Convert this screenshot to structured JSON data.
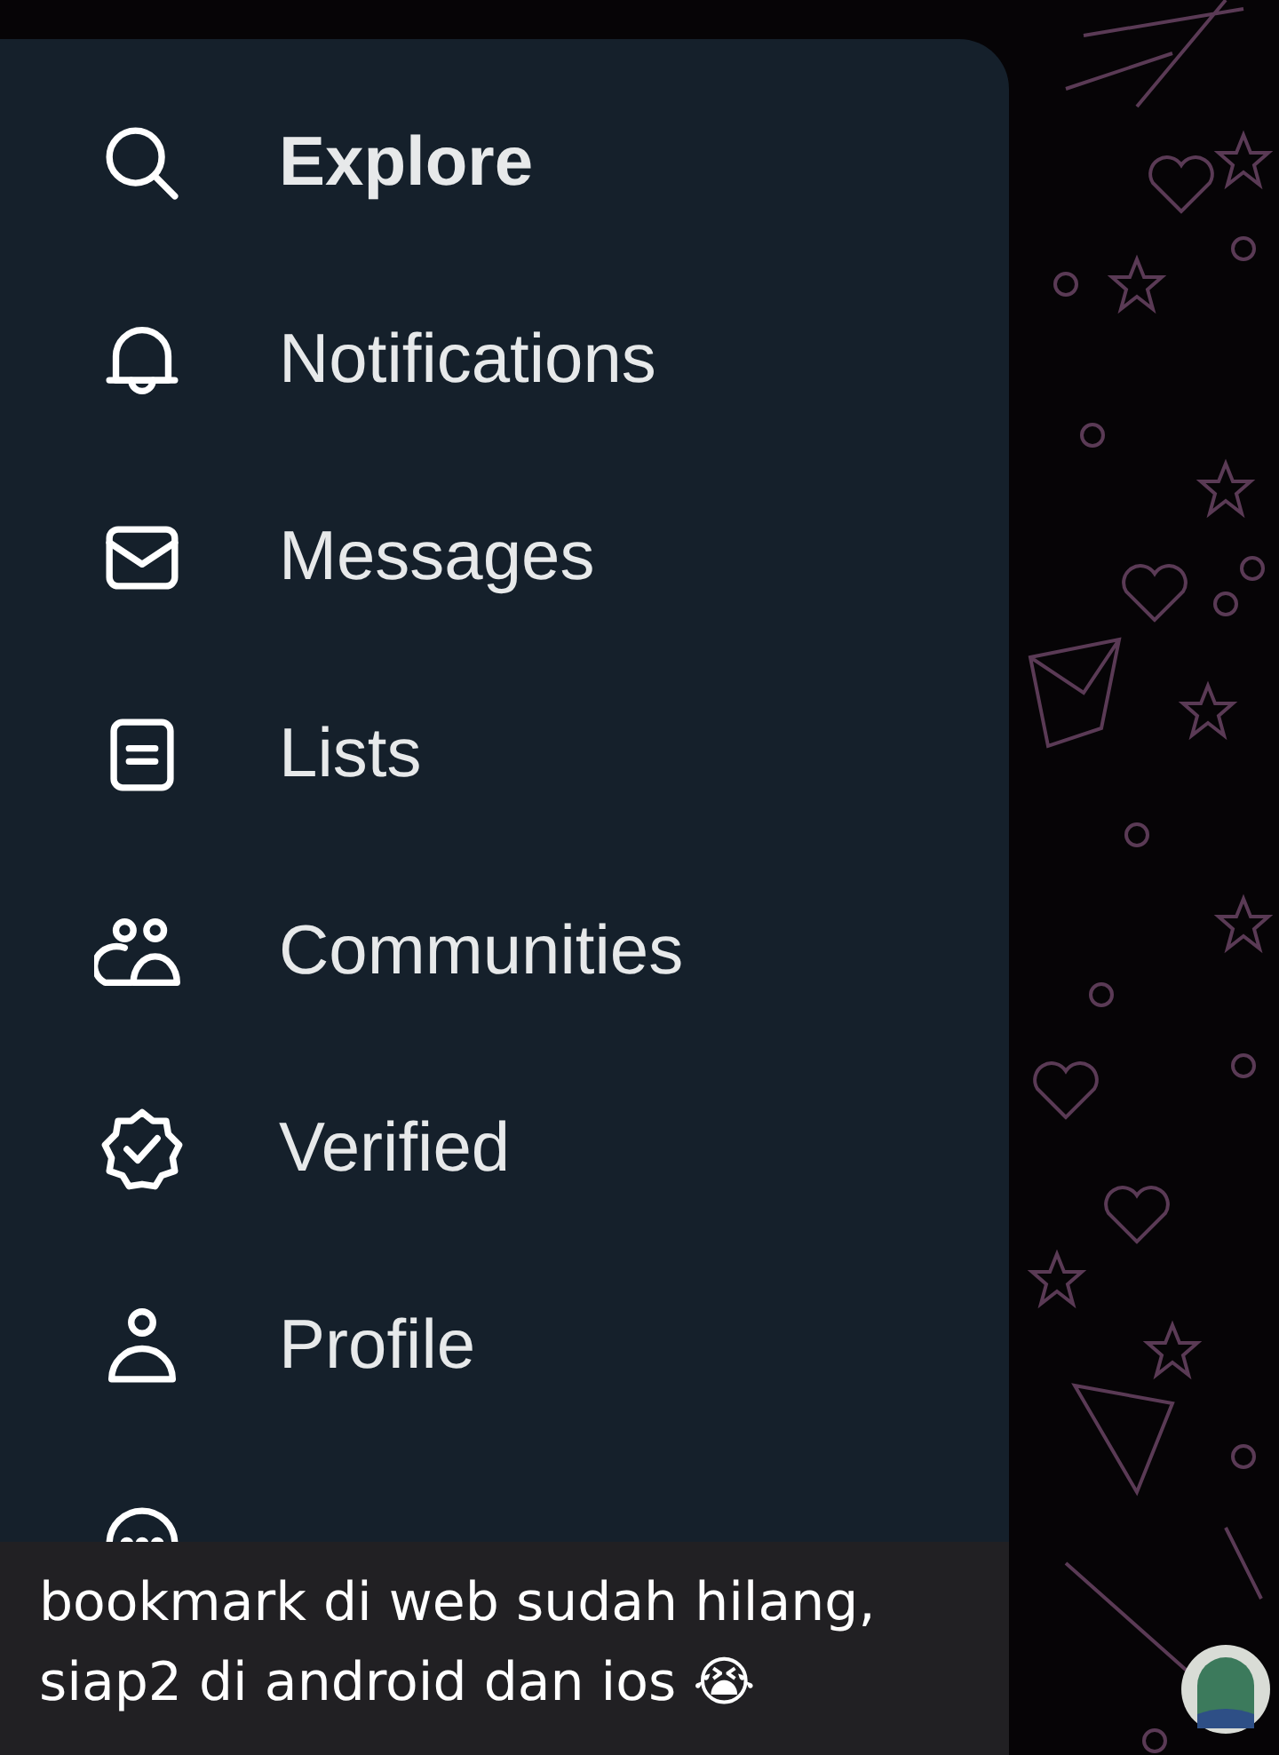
{
  "menu": {
    "items": [
      {
        "label": "Explore",
        "kind": "search",
        "selected": true
      },
      {
        "label": "Notifications",
        "kind": "bell",
        "selected": false
      },
      {
        "label": "Messages",
        "kind": "envelope",
        "selected": false
      },
      {
        "label": "Lists",
        "kind": "list",
        "selected": false
      },
      {
        "label": "Communities",
        "kind": "people",
        "selected": false
      },
      {
        "label": "Verified",
        "kind": "badge",
        "selected": false
      },
      {
        "label": "Profile",
        "kind": "person",
        "selected": false
      },
      {
        "kind": "more"
      }
    ]
  },
  "caption": "bookmark di web sudah hilang, siap2 di android dan ios 😭"
}
